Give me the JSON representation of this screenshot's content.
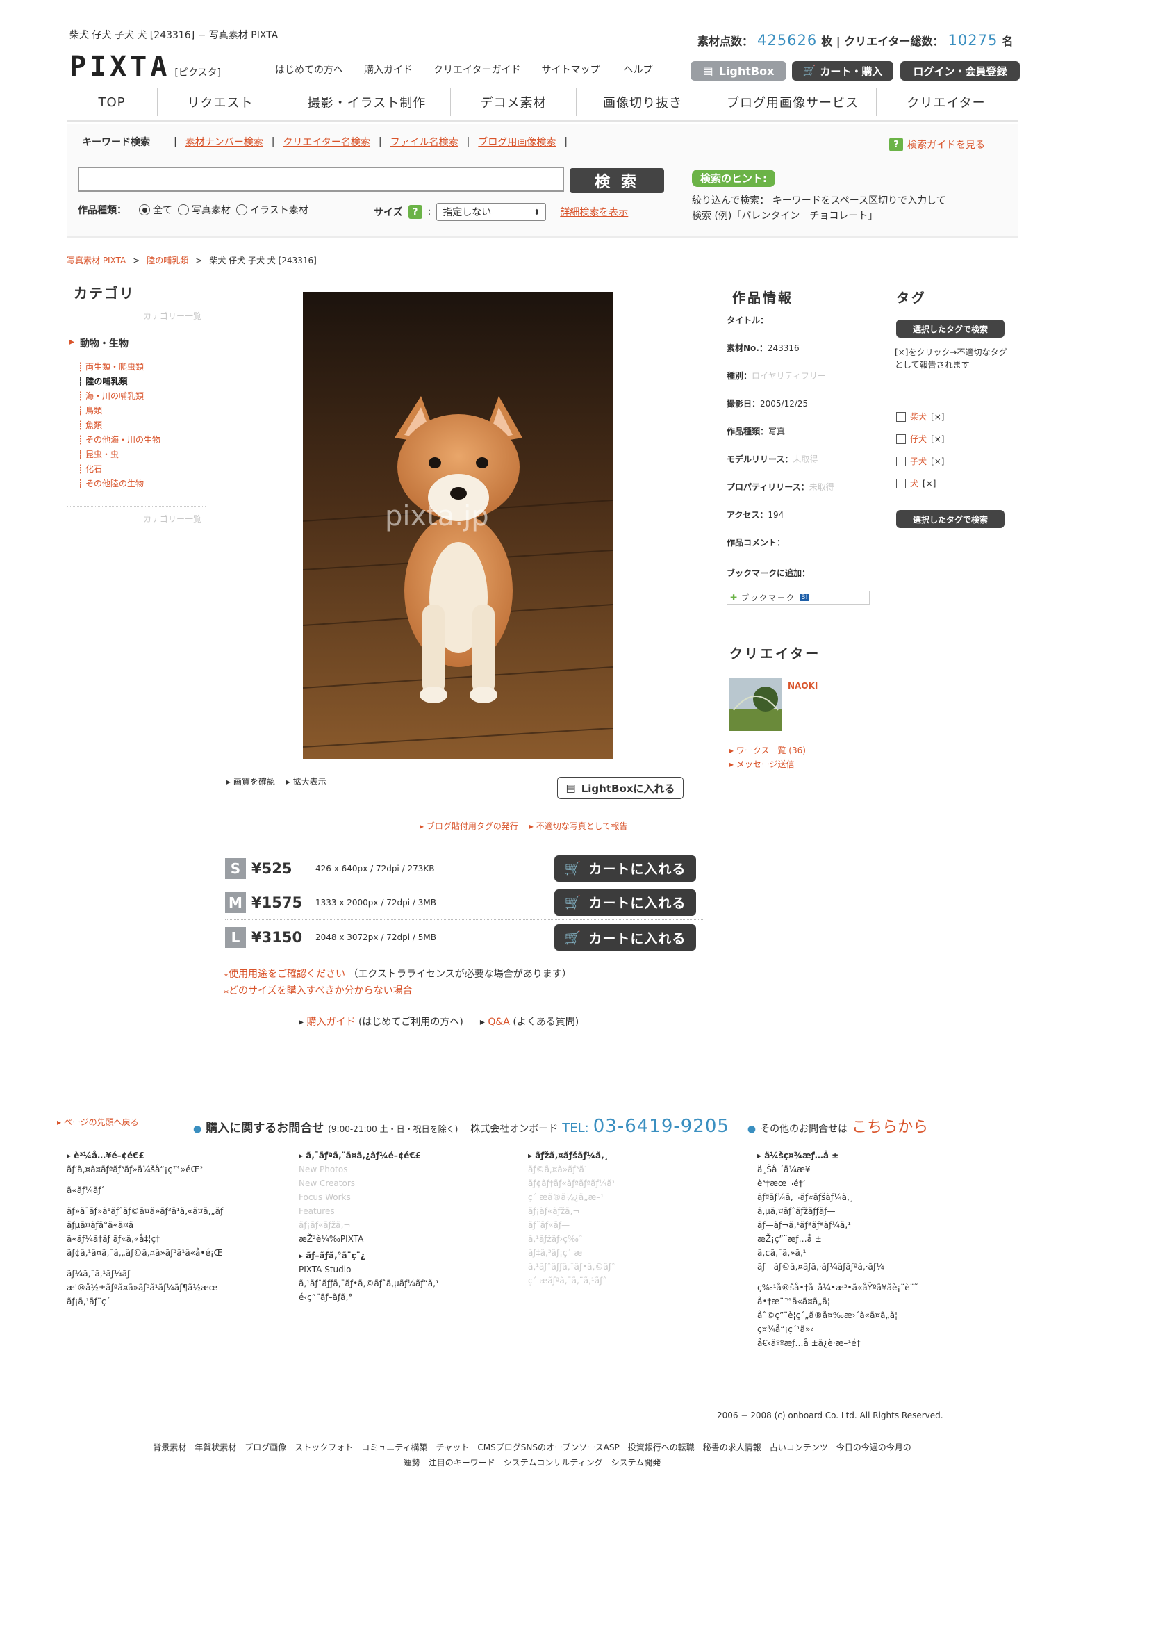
{
  "header": {
    "page_title": "柴犬 仔犬 子犬 犬 [243316] − 写真素材 PIXTA",
    "stats_label1": "素材点数：",
    "stats_count1": "425626",
    "stats_unit1": "枚 | クリエイター総数：",
    "stats_count2": "10275",
    "stats_unit2": "名",
    "logo": "PIXTA",
    "logo_kana": "[ピクスタ]",
    "links": [
      "はじめての方へ",
      "購入ガイド",
      "クリエイターガイド",
      "サイトマップ",
      "ヘルプ"
    ],
    "lightbox_btn": "LightBox",
    "cart_btn": "カート・購入",
    "login_btn": "ログイン・会員登録"
  },
  "nav": {
    "tabs": [
      "TOP",
      "リクエスト",
      "撮影・イラスト制作",
      "デコメ素材",
      "画像切り抜き",
      "ブログ用画像サービス",
      "クリエイター"
    ]
  },
  "search": {
    "tabs": [
      "キーワード検索",
      "素材ナンバー検索",
      "クリエイター名検索",
      "ファイル名検索",
      "ブログ用画像検索"
    ],
    "guide_link": "検索ガイドを見る",
    "input_value": "",
    "search_btn": "検 索",
    "hint_badge": "検索のヒント:",
    "hint_line1": "絞り込んで検索： キーワードをスペース区切りで入力して",
    "hint_line2": "検索 (例)「バレンタイン　チョコレート」",
    "type_label": "作品種類：",
    "type_options": [
      "全て",
      "写真素材",
      "イラスト素材"
    ],
    "size_label": "サイズ",
    "size_select": "指定しない",
    "detail_link": "詳細検索を表示"
  },
  "breadcrumb": {
    "items": [
      "写真素材 PIXTA",
      "陸の哺乳類",
      "柴犬 仔犬 子犬 犬 [243316]"
    ]
  },
  "sidebar": {
    "heading": "カテゴリ",
    "top_faint": "カテゴリー一覧",
    "parent": "動物・生物",
    "items": [
      "両生類・爬虫類",
      "陸の哺乳類",
      "海・川の哺乳類",
      "鳥類",
      "魚類",
      "その他海・川の生物",
      "昆虫・虫",
      "化石",
      "その他陸の生物"
    ],
    "bottom_faint": "カテゴリー一覧"
  },
  "photo": {
    "watermark": "pixta.jp",
    "link_quality": "画質を確認",
    "link_zoom": "拡大表示",
    "lightbox_add": "LightBoxに入れる",
    "blog_tag_link": "ブログ貼付用タグの発行",
    "report_link": "不適切な写真として報告"
  },
  "work_info": {
    "heading": "作品情報",
    "rows": [
      {
        "label": "タイトル：",
        "value": ""
      },
      {
        "label": "素材No.：",
        "value": "243316"
      },
      {
        "label": "種別：",
        "value": "ロイヤリティフリー"
      },
      {
        "label": "撮影日：",
        "value": "2005/12/25"
      },
      {
        "label": "作品種類：",
        "value": "写真"
      },
      {
        "label": "モデルリリース：",
        "value": "未取得"
      },
      {
        "label": "プロパティリリース：",
        "value": "未取得"
      },
      {
        "label": "アクセス：",
        "value": "194"
      },
      {
        "label": "作品コメント：",
        "value": ""
      }
    ],
    "bookmark_label": "ブックマークに追加：",
    "bookmark_widget": "ブックマーク"
  },
  "tags": {
    "heading": "タグ",
    "search_btn": "選択したタグで検索",
    "note": "[×]をクリック→不適切なタグとして報告されます",
    "items": [
      {
        "name": "柴犬",
        "x": "[×]"
      },
      {
        "name": "仔犬",
        "x": "[×]"
      },
      {
        "name": "子犬",
        "x": "[×]"
      },
      {
        "name": "犬",
        "x": "[×]"
      }
    ]
  },
  "creator": {
    "heading": "クリエイター",
    "name": "NAOKI",
    "links": [
      "ワークス一覧 (36)",
      "メッセージ送信"
    ]
  },
  "pricing": {
    "rows": [
      {
        "size": "S",
        "price": "¥525",
        "spec": "426 x 640px / 72dpi / 273KB",
        "btn": "カートに入れる"
      },
      {
        "size": "M",
        "price": "¥1575",
        "spec": "1333 x 2000px / 72dpi / 3MB",
        "btn": "カートに入れる"
      },
      {
        "size": "L",
        "price": "¥3150",
        "spec": "2048 x 3072px / 72dpi / 5MB",
        "btn": "カートに入れる"
      }
    ],
    "note1_link": "使用用途をご確認ください",
    "note1_rest": "（エクストラライセンスが必要な場合があります）",
    "note2_link": "どのサイズを購入すべきか分からない場合",
    "guide_link": "購入ガイド",
    "guide_rest": "(はじめてご利用の方へ)",
    "qa_link": "Q&A",
    "qa_rest": "(よくある質問)"
  },
  "footer": {
    "back_top": "ページの先頭へ戻る",
    "contact_label": "購入に関するお問合せ",
    "contact_hours": "(9:00-21:00 土・日・祝日を除く)",
    "company": "株式会社オンボード",
    "tel_label": "TEL:",
    "tel": "03-6419-9205",
    "other_label": "その他のお問合せは",
    "other_link": "こちらから",
    "col1": {
      "title": "è³¼å…¥é–¢é€£",
      "lines": [
        "ãƒ‘ã‚¤ã¤ãƒªãƒ³ãƒ»ä¼šå“¡ç™»éŒ²",
        "ã«ãƒ¼ãƒˆ",
        "ãƒ»ã¯ãƒ»ã¹ãƒˆãƒ©ã¤ã»ãƒ³ã¹ã‚«ã¤ã‚„ãƒ",
        "ãƒµã¤ãƒã°ã«ã¤ã",
        "ã«ãƒ¼ã†ãƒ ãƒ«ã‚«å‡¦ç†",
        "ãƒ¢ã‚¹ã¤ã‚¯ã‚„ãƒ©ã‚¤ã»ãƒ³ã¹ã«å•é¡Œ",
        "ãƒ¼ã‚¯ã‚¹ãƒ¼ãƒ",
        "æ'®å½±ãƒªã¤ã»ãƒ³ã¹ãƒ¼ãƒ¶ã½æœ",
        "ãƒ¡ã‚¹ãƒ¨ç´"
      ]
    },
    "col2": {
      "title": "ã‚¯ãƒªã‚¨ã¤ã‚¿ãƒ¼é–¢é€£",
      "faint": [
        "New Photos",
        "New Creators",
        "Focus Works",
        "Features",
        "ãƒ¡ãƒ«ãƒžã‚¬"
      ],
      "lines": [
        "æŽ²è¼‰PIXTA"
      ],
      "title2": "ãƒ–ãƒ­ã‚°ã¨ç¨¿",
      "lines2": [
        "PIXTA Studio",
        "ã‚¹ãƒˆãƒƒã‚¯ãƒ•ã‚©ãƒˆã‚µãƒ¼ãƒ“ã‚¹",
        "é‹ç”¨ãƒ–ãƒ­ã‚°"
      ]
    },
    "col3": {
      "title": "ãƒžã‚¤ãƒšãƒ¼ã‚¸",
      "faint": [
        "ãƒ©ã‚¤ã»ãƒ³ã¹",
        "ãƒ¢ãƒ‡ãƒ«ãƒªãƒªãƒ¼ã¹",
        "ç´ æã®ä½¿ã„æ–¹",
        "ãƒ¡ãƒ«ãƒžã‚¬",
        "ãƒ˜ãƒ«ãƒ—",
        "ã‚¹ãƒžãƒ›ç‰ˆ",
        "ãƒ‡ã‚³ãƒ¡ç´ æ",
        "ã‚¹ãƒˆãƒƒã‚¯ãƒ•ã‚©ãƒˆ",
        "ç´ æãƒªã‚¯ã‚¨ã‚¹ãƒˆ"
      ]
    },
    "col4": {
      "title": "ä¼šç¤¾æƒ…å ±",
      "lines": [
        "ä¸Šå ´ä¼æ¥­",
        "è³‡æœ¬é‡‘",
        "ãƒªãƒ¼ã‚¬ãƒ«ãƒšãƒ¼ã‚¸",
        "ã‚µã‚¤ãƒˆãƒžãƒƒãƒ—",
        "ãƒ—ãƒ¬ã‚¹ãƒªãƒªãƒ¼ã‚¹",
        "æŽ¡ç”¨æƒ…å ±",
        "ã‚¢ã‚¯ã‚»ã‚¹",
        "ãƒ—ãƒ©ã‚¤ãƒã‚·ãƒ¼ãƒãƒªã‚·ãƒ¼",
        "ç‰¹å®šå•†å–å¼•æ³•ã«åŸºã¥ãè¡¨è¨˜",
        "å•†æ¨™ã«ã¤ã„ã¦",
        "åˆ©ç”¨è¦ç´„ã®å¤‰æ›´ã«ã¤ã„ã¦",
        "ç¤¾å“¡ç´¹ä»‹",
        "å€‹äººæƒ…å ±ä¿è­·æ–¹é‡"
      ]
    },
    "copyright": "2006 − 2008 (c) onboard Co. Ltd. All Rights Reserved.",
    "bottom_links_line1": "背景素材　年賀状素材　ブログ画像　ストックフォト　コミュニティ構築　チャット　CMSブログSNSのオープンソースASP　投資銀行への転職　秘書の求人情報　占いコンテンツ　今日の今週の今月の",
    "bottom_links_line2": "運勢　注目のキーワード　システムコンサルティング　システム開発"
  },
  "colors": {
    "accent_blue": "#3a8fc0",
    "accent_orange": "#d9542b",
    "dark_button": "#3c3c3c",
    "hint_green": "#6bb347"
  }
}
